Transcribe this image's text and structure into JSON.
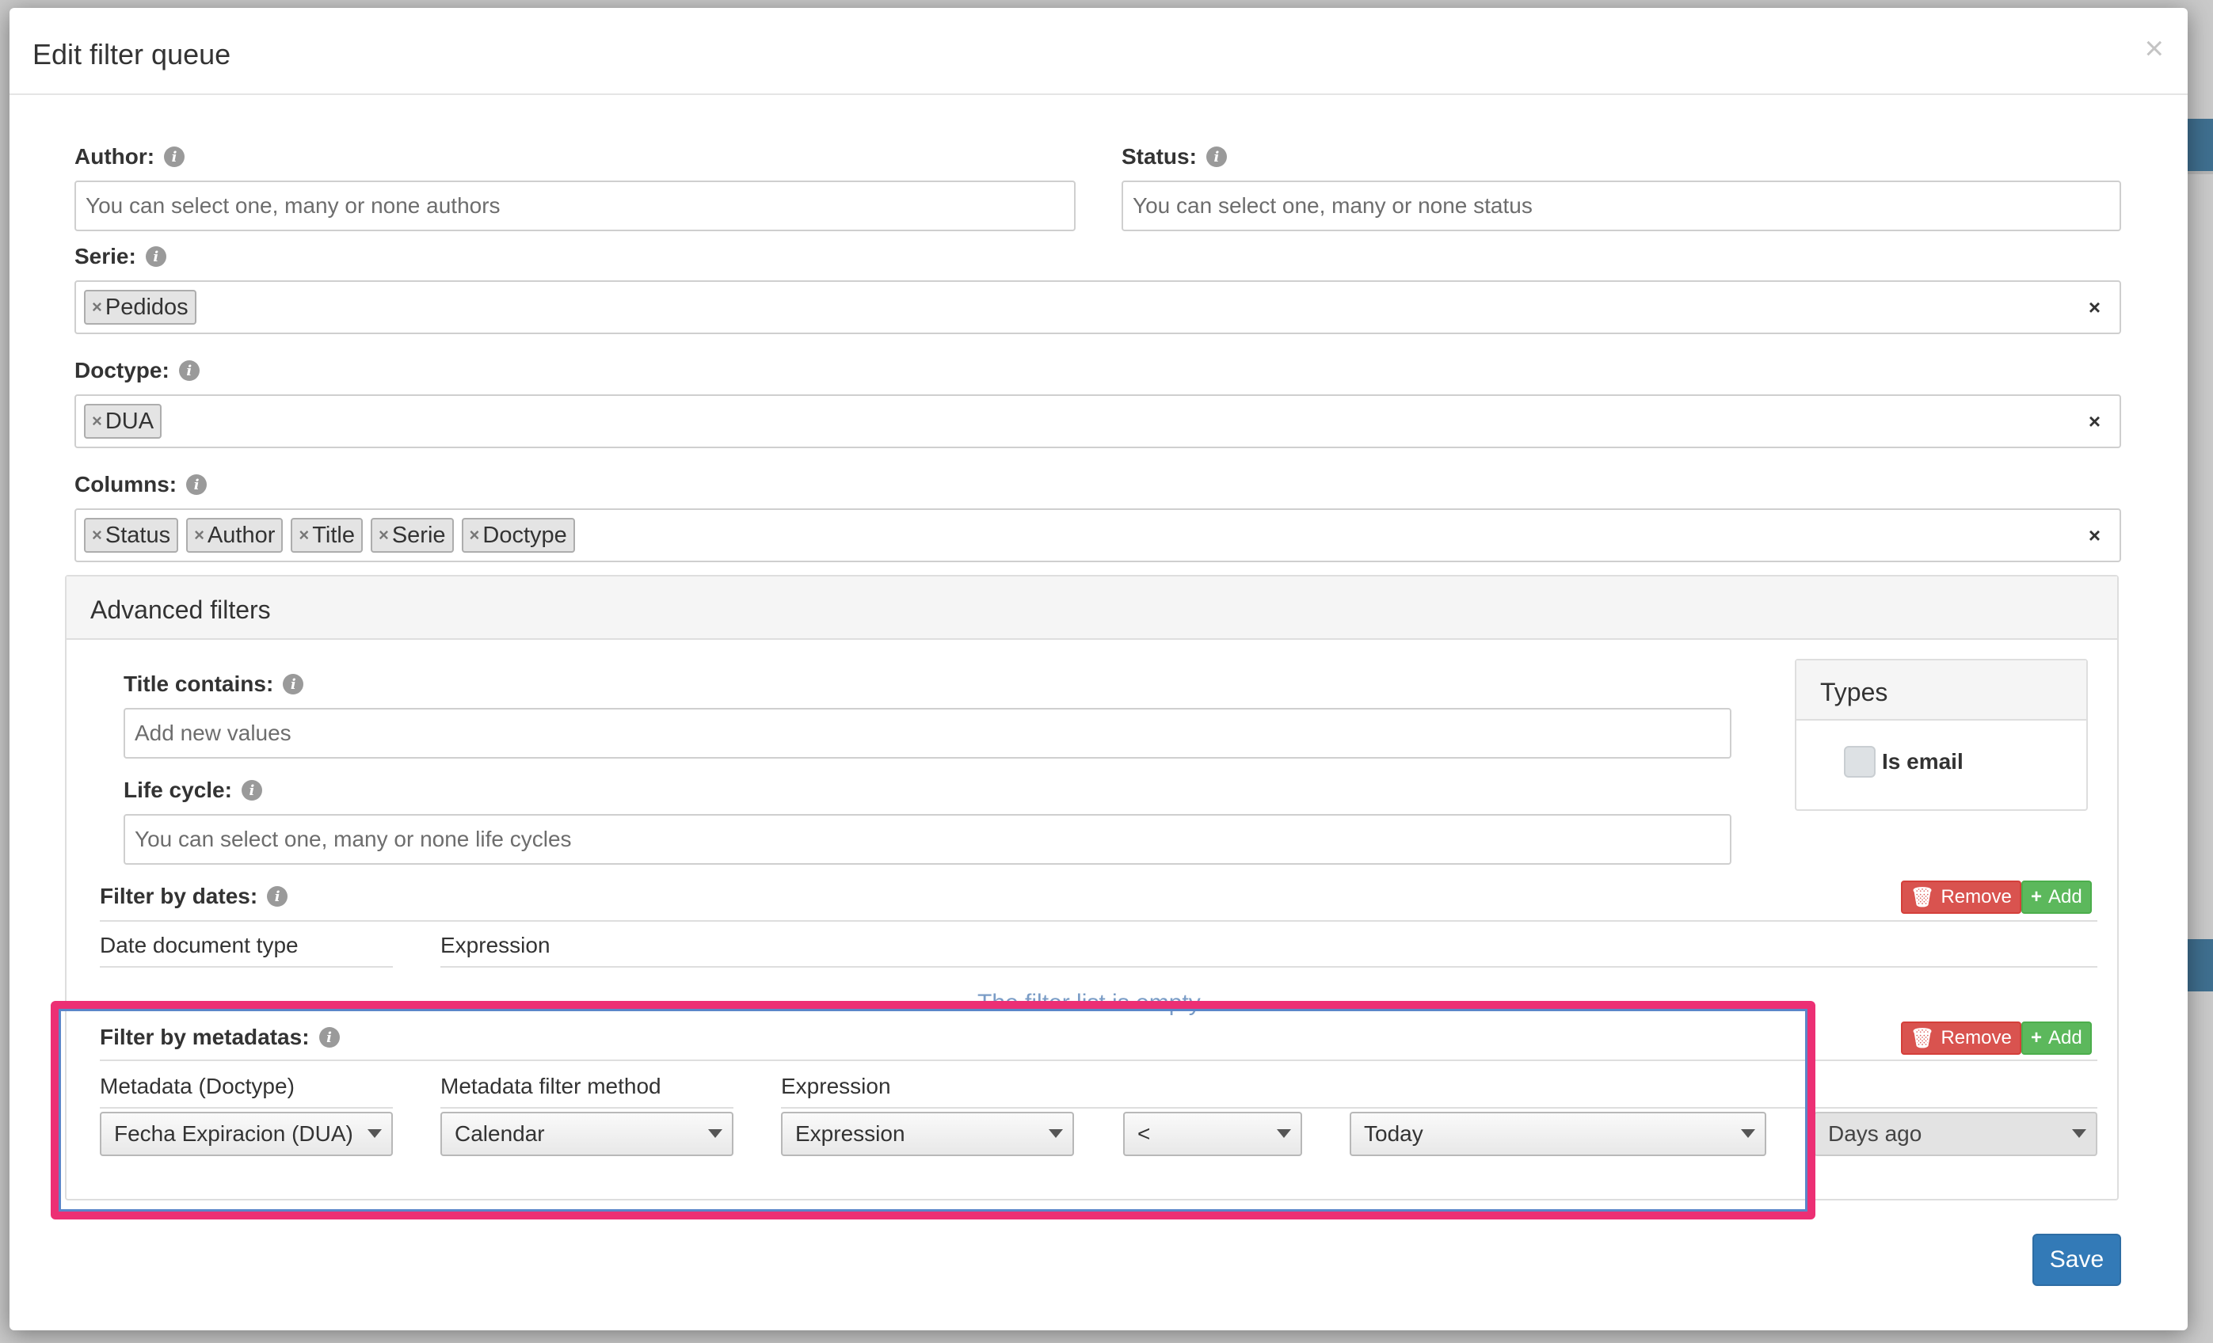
{
  "modal": {
    "title": "Edit filter queue",
    "close_label": "×"
  },
  "author": {
    "label": "Author:",
    "placeholder": "You can select one, many or none authors"
  },
  "status": {
    "label": "Status:",
    "placeholder": "You can select one, many or none status"
  },
  "serie": {
    "label": "Serie:",
    "tags": [
      "Pedidos"
    ]
  },
  "doctype": {
    "label": "Doctype:",
    "tags": [
      "DUA"
    ]
  },
  "columns": {
    "label": "Columns:",
    "tags": [
      "Status",
      "Author",
      "Title",
      "Serie",
      "Doctype"
    ]
  },
  "tag_remove": "×",
  "clear_all": "×",
  "advanced": {
    "title": "Advanced filters",
    "title_contains": {
      "label": "Title contains:",
      "placeholder": "Add new values"
    },
    "life_cycle": {
      "label": "Life cycle:",
      "placeholder": "You can select one, many or none life cycles"
    },
    "types": {
      "title": "Types",
      "is_email_label": "Is email",
      "is_email_checked": false
    },
    "filter_dates": {
      "label": "Filter by dates:",
      "col_doc_type": "Date document type",
      "col_expression": "Expression",
      "empty": "The filter list is empty",
      "remove_label": "Remove",
      "add_label": "Add"
    },
    "filter_metadatas": {
      "label": "Filter by metadatas:",
      "col_metadata": "Metadata (Doctype)",
      "col_method": "Metadata filter method",
      "col_expression": "Expression",
      "remove_label": "Remove",
      "add_label": "Add",
      "row": {
        "metadata": "Fecha Expiracion (DUA)",
        "method": "Calendar",
        "expression_type": "Expression",
        "operator": "<",
        "reference": "Today",
        "unit": "Days ago"
      }
    }
  },
  "save_label": "Save",
  "colors": {
    "primary": "#337ab7",
    "danger": "#d9534f",
    "success": "#5cb85c",
    "highlight": "#ec2f74"
  }
}
